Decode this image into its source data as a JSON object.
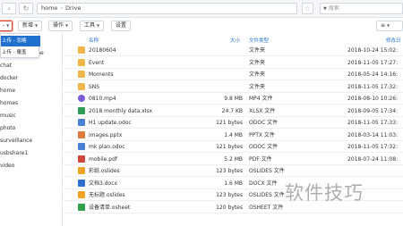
{
  "address": {
    "back": "‹",
    "refresh": "↻",
    "path": [
      "home",
      "Drive"
    ],
    "star": "☆",
    "search_placeholder": "搜索",
    "search_filter": "▼"
  },
  "toolbar": {
    "upload_label": "-",
    "new_label": "新增",
    "action_label": "操作",
    "tools_label": "工具",
    "settings_label": "设置",
    "view_label": "≡"
  },
  "upload_menu": {
    "items": [
      "上传 - 忽略",
      "上传 - 覆盖"
    ]
  },
  "sidebar": {
    "items": [
      "rBusine",
      "chat",
      "docker",
      "home",
      "homes",
      "music",
      "photo",
      "surveillance",
      "usbshare1",
      "video"
    ]
  },
  "columns": {
    "name": "名称",
    "size": "大小",
    "type": "文件类型",
    "date": "修改日"
  },
  "files": [
    {
      "name": "20180604",
      "size": "",
      "type": "文件夹",
      "date": "2018-10-24 15:02:",
      "icon": "folder"
    },
    {
      "name": "Event",
      "size": "",
      "type": "文件夹",
      "date": "2018-11-05 17:27:",
      "icon": "folder"
    },
    {
      "name": "Moments",
      "size": "",
      "type": "文件夹",
      "date": "2018-05-24 14:16:",
      "icon": "folder"
    },
    {
      "name": "SNS",
      "size": "",
      "type": "文件夹",
      "date": "2018-11-05 17:32:",
      "icon": "folder"
    },
    {
      "name": "0810.mp4",
      "size": "9.8 MB",
      "type": "MP4 文件",
      "date": "2018-08-10 10:26:",
      "icon": "mp4"
    },
    {
      "name": "2018 monthly data.xlsx",
      "size": "24.7 KB",
      "type": "XLSX 文件",
      "date": "2018-09-05 17:34:",
      "icon": "xlsx"
    },
    {
      "name": "H1 update.odoc",
      "size": "121 bytes",
      "type": "ODOC 文件",
      "date": "2018-11-05 17:33:",
      "icon": "doc"
    },
    {
      "name": "images.pptx",
      "size": "1.4 MB",
      "type": "PPTX 文件",
      "date": "2018-03-14 11:03:",
      "icon": "pptx"
    },
    {
      "name": "mk plan.odoc",
      "size": "121 bytes",
      "type": "ODOC 文件",
      "date": "2018-11-05 17:32:",
      "icon": "doc"
    },
    {
      "name": "mobile.pdf",
      "size": "5.2 MB",
      "type": "PDF 文件",
      "date": "2018-07-24 11:08:",
      "icon": "pdf"
    },
    {
      "name": "彩纸.oslides",
      "size": "123 bytes",
      "type": "OSLIDES 文件",
      "date": "",
      "icon": "slides"
    },
    {
      "name": "文档3.docx",
      "size": "1.6 MB",
      "type": "DOCX 文件",
      "date": "",
      "icon": "docx"
    },
    {
      "name": "无标题.oslides",
      "size": "123 bytes",
      "type": "OSLIDES 文件",
      "date": "",
      "icon": "slides"
    },
    {
      "name": "设备清单.osheet",
      "size": "120 bytes",
      "type": "OSHEET 文件",
      "date": "",
      "icon": "sheet"
    }
  ],
  "watermark": "软件技巧"
}
